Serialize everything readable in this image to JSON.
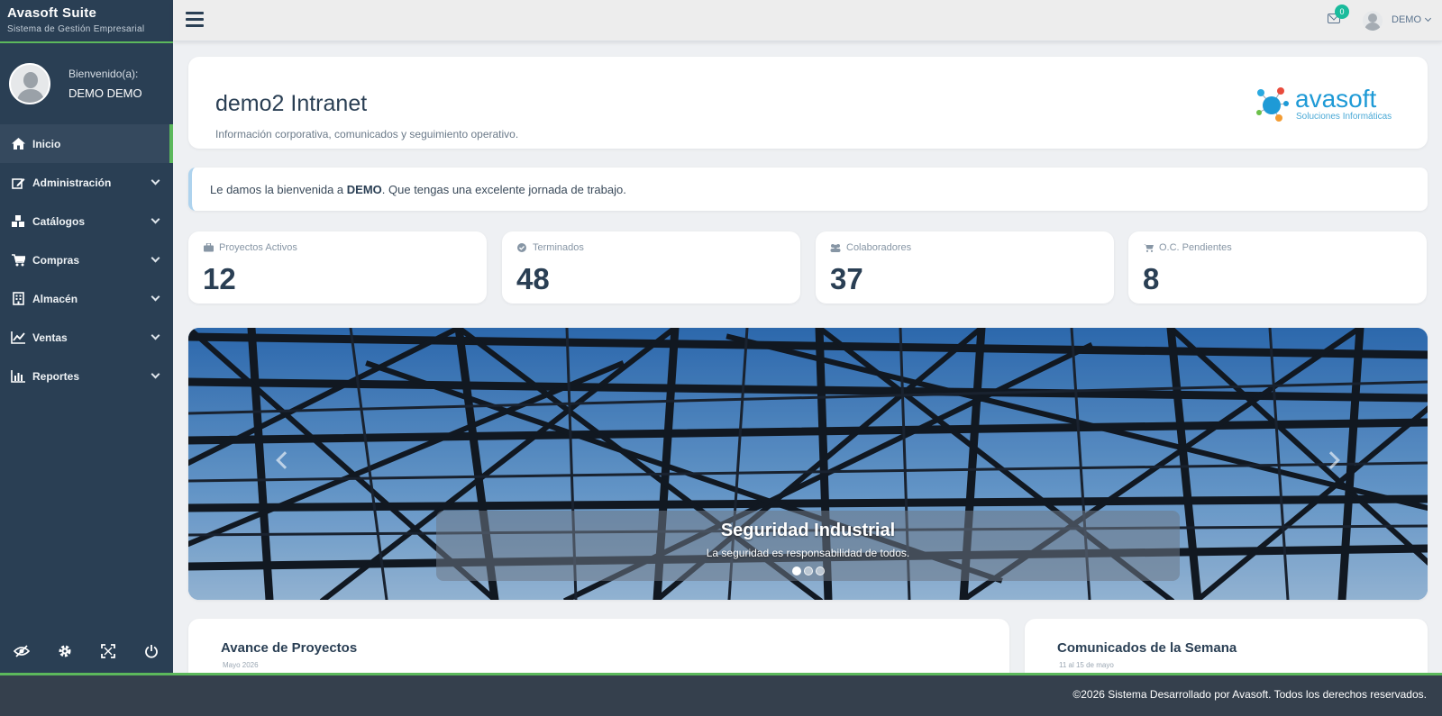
{
  "app": {
    "title": "Avasoft Suite",
    "subtitle": "Sistema de Gestión Empresarial"
  },
  "profile": {
    "welcome": "Bienvenido(a):",
    "name": "DEMO DEMO"
  },
  "sidebar": {
    "items": [
      {
        "label": "Inicio",
        "icon": "home-icon",
        "active": true
      },
      {
        "label": "Administración",
        "icon": "edit-icon"
      },
      {
        "label": "Catálogos",
        "icon": "cubes-icon"
      },
      {
        "label": "Compras",
        "icon": "cart-icon"
      },
      {
        "label": "Almacén",
        "icon": "building-icon"
      },
      {
        "label": "Ventas",
        "icon": "line-chart-icon"
      },
      {
        "label": "Reportes",
        "icon": "bar-chart-icon"
      }
    ],
    "footer_icons": [
      "eye-slash-icon",
      "gear-icon",
      "fullscreen-icon",
      "power-icon"
    ]
  },
  "topnav": {
    "mail_count": "0",
    "user": "DEMO"
  },
  "header": {
    "title": "demo2 Intranet",
    "subtitle": "Información corporativa, comunicados y seguimiento operativo.",
    "logo_text": "avasoft",
    "logo_tagline": "Soluciones Informáticas"
  },
  "welcome_bar": {
    "prefix": "Le damos la bienvenida a ",
    "name": "DEMO",
    "suffix": ". Que tengas una excelente jornada de trabajo."
  },
  "stats": [
    {
      "label": "Proyectos Activos",
      "value": "12",
      "icon": "briefcase-icon"
    },
    {
      "label": "Terminados",
      "value": "48",
      "icon": "check-circle-icon"
    },
    {
      "label": "Colaboradores",
      "value": "37",
      "icon": "users-icon"
    },
    {
      "label": "O.C. Pendientes",
      "value": "8",
      "icon": "cart-icon"
    }
  ],
  "carousel": {
    "title": "Seguridad Industrial",
    "text": "La seguridad es responsabilidad de todos.",
    "slides": 3,
    "active_slide": 1
  },
  "panels": {
    "left": {
      "title": "Avance de Proyectos",
      "sub": "Mayo 2026"
    },
    "right": {
      "title": "Comunicados de la Semana",
      "sub": "11 al 15 de mayo"
    }
  },
  "footer": {
    "text": "©2026 Sistema Desarrollado por Avasoft. Todos los derechos reservados."
  },
  "colors": {
    "sidebar": "#2a3f54",
    "accent": "#5cb85c",
    "badge": "#1abb9c",
    "footer": "#35404d"
  }
}
